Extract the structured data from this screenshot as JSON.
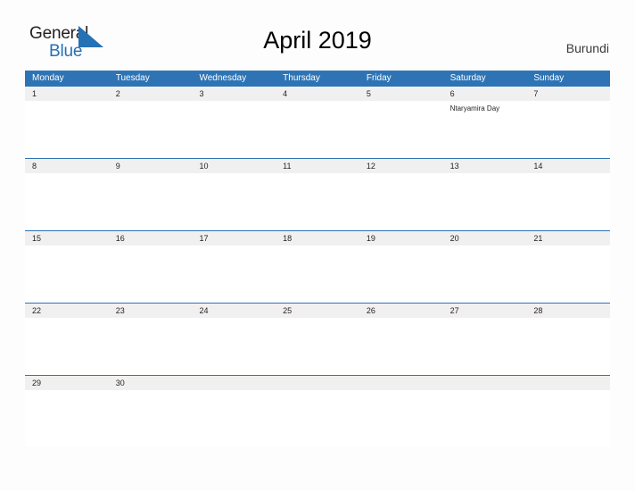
{
  "brand": {
    "word_one": "General",
    "word_two": "Blue",
    "mark": "blue-triangle-flag",
    "color_dark": "#231f20",
    "color_blue": "#2471b5"
  },
  "header": {
    "title": "April 2019",
    "subtitle": "Burundi"
  },
  "theme": {
    "header_blue": "#2e74b5",
    "date_band_gray": "#f0f0f0",
    "cell_white": "#ffffff",
    "page_background": "#fdfdfd",
    "text_dark": "#231f20",
    "weekday_text": "#ffffff"
  },
  "calendar": {
    "weekdays": [
      "Monday",
      "Tuesday",
      "Wednesday",
      "Thursday",
      "Friday",
      "Saturday",
      "Sunday"
    ],
    "weeks": [
      {
        "dates": [
          "1",
          "2",
          "3",
          "4",
          "5",
          "6",
          "7"
        ],
        "events": [
          "",
          "",
          "",
          "",
          "",
          "Ntaryamira Day",
          ""
        ]
      },
      {
        "dates": [
          "8",
          "9",
          "10",
          "11",
          "12",
          "13",
          "14"
        ],
        "events": [
          "",
          "",
          "",
          "",
          "",
          "",
          ""
        ]
      },
      {
        "dates": [
          "15",
          "16",
          "17",
          "18",
          "19",
          "20",
          "21"
        ],
        "events": [
          "",
          "",
          "",
          "",
          "",
          "",
          ""
        ]
      },
      {
        "dates": [
          "22",
          "23",
          "24",
          "25",
          "26",
          "27",
          "28"
        ],
        "events": [
          "",
          "",
          "",
          "",
          "",
          "",
          ""
        ]
      },
      {
        "dates": [
          "29",
          "30",
          "",
          "",
          "",
          "",
          ""
        ],
        "events": [
          "",
          "",
          "",
          "",
          "",
          "",
          ""
        ]
      }
    ]
  }
}
